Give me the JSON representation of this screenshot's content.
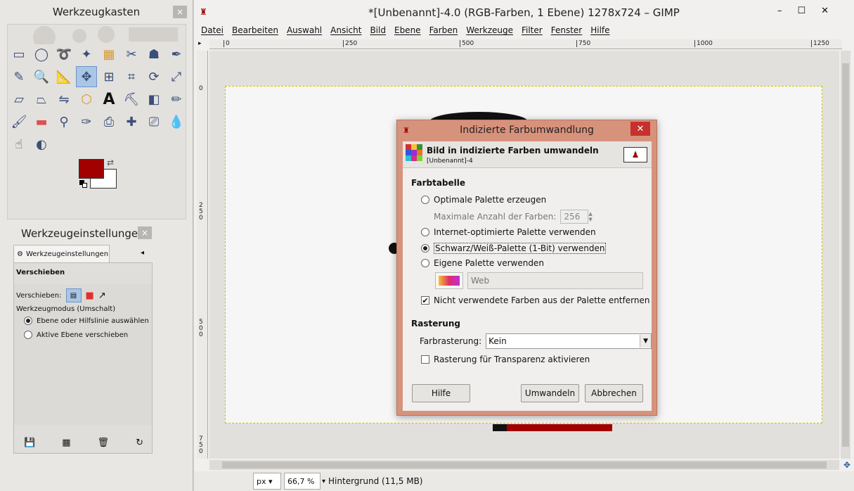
{
  "toolbox": {
    "title": "Werkzeugkasten",
    "tools": [
      {
        "icon": "rect-select-icon"
      },
      {
        "icon": "ellipse-select-icon"
      },
      {
        "icon": "free-select-icon"
      },
      {
        "icon": "fuzzy-select-icon"
      },
      {
        "icon": "color-select-icon"
      },
      {
        "icon": "scissors-icon"
      },
      {
        "icon": "foreground-select-icon"
      },
      {
        "icon": "paths-icon"
      },
      {
        "icon": "color-picker-icon"
      },
      {
        "icon": "zoom-icon"
      },
      {
        "icon": "measure-icon"
      },
      {
        "icon": "move-icon"
      },
      {
        "icon": "align-icon"
      },
      {
        "icon": "crop-icon"
      },
      {
        "icon": "rotate-icon"
      },
      {
        "icon": "scale-icon"
      },
      {
        "icon": "shear-icon"
      },
      {
        "icon": "perspective-icon"
      },
      {
        "icon": "flip-icon"
      },
      {
        "icon": "cage-icon"
      },
      {
        "icon": "text-icon"
      },
      {
        "icon": "bucket-fill-icon"
      },
      {
        "icon": "blend-icon"
      },
      {
        "icon": "pencil-icon"
      },
      {
        "icon": "paintbrush-icon"
      },
      {
        "icon": "eraser-icon"
      },
      {
        "icon": "airbrush-icon"
      },
      {
        "icon": "ink-icon"
      },
      {
        "icon": "clone-icon"
      },
      {
        "icon": "heal-icon"
      },
      {
        "icon": "perspective-clone-icon"
      },
      {
        "icon": "blur-icon"
      },
      {
        "icon": "smudge-icon"
      },
      {
        "icon": "dodge-burn-icon"
      }
    ],
    "fg_color": "#a00000",
    "bg_color": "#ffffff"
  },
  "tool_options": {
    "title": "Werkzeugeinstellungen",
    "tab_label": "Werkzeugeinstellungen",
    "tool_name": "Verschieben",
    "move_label": "Verschieben:",
    "mode_label": "Werkzeugmodus (Umschalt)",
    "mode_options": [
      "Ebene oder Hilfslinie auswählen",
      "Aktive Ebene verschieben"
    ],
    "mode_selected": 0
  },
  "main": {
    "title": "*[Unbenannt]-4.0 (RGB-Farben, 1 Ebene) 1278x724 – GIMP",
    "menu": [
      "Datei",
      "Bearbeiten",
      "Auswahl",
      "Ansicht",
      "Bild",
      "Ebene",
      "Farben",
      "Werkzeuge",
      "Filter",
      "Fenster",
      "Hilfe"
    ],
    "ruler_h": [
      "0",
      "250",
      "500",
      "750",
      "1000",
      "1250"
    ],
    "ruler_v": [
      "0",
      "250",
      "500",
      "750"
    ],
    "status": {
      "unit": "px",
      "zoom": "66,7 %",
      "layer": "Hintergrund (11,5 MB)"
    }
  },
  "dialog": {
    "title": "Indizierte Farbumwandlung",
    "header_title": "Bild in indizierte Farben umwandeln",
    "header_sub": "[Unbenannt]-4",
    "palette_section": "Farbtabelle",
    "opt_optimal": "Optimale Palette erzeugen",
    "max_colors_label": "Maximale Anzahl der Farben:",
    "max_colors_value": "256",
    "opt_web": "Internet-optimierte Palette verwenden",
    "opt_bw": "Schwarz/Weiß-Palette (1-Bit) verwenden",
    "opt_custom": "Eigene Palette verwenden",
    "custom_palette_name": "Web",
    "remove_unused": "Nicht verwendete Farben aus der Palette entfernen",
    "remove_unused_checked": true,
    "dither_section": "Rasterung",
    "dither_label": "Farbrasterung:",
    "dither_value": "Kein",
    "dither_transparency": "Rasterung für Transparenz aktivieren",
    "btn_help": "Hilfe",
    "btn_convert": "Umwandeln",
    "btn_cancel": "Abbrechen"
  },
  "colors": {
    "accent": "#a00000",
    "dialog_frame": "#d7927c",
    "close_red": "#c7302b",
    "active_tool": "#a9c6e6"
  }
}
